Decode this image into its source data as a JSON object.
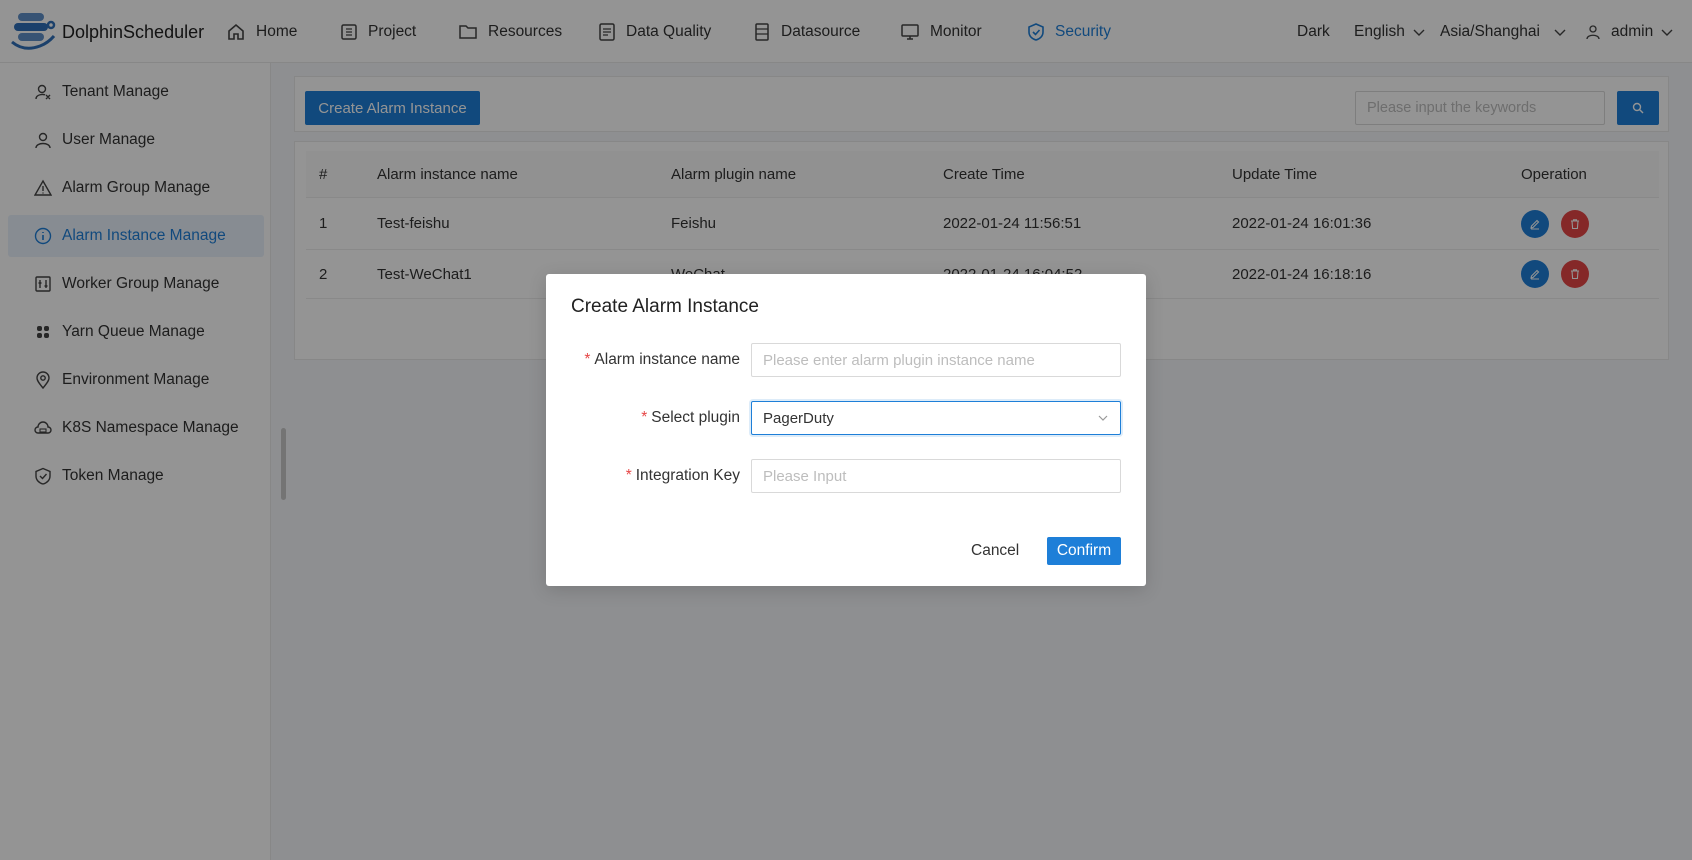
{
  "app": {
    "name": "DolphinScheduler"
  },
  "nav": [
    {
      "label": "Home",
      "icon": "home-icon"
    },
    {
      "label": "Project",
      "icon": "project-icon"
    },
    {
      "label": "Resources",
      "icon": "folder-icon"
    },
    {
      "label": "Data Quality",
      "icon": "data-quality-icon"
    },
    {
      "label": "Datasource",
      "icon": "datasource-icon"
    },
    {
      "label": "Monitor",
      "icon": "monitor-icon"
    },
    {
      "label": "Security",
      "icon": "shield-icon",
      "active": true
    }
  ],
  "header_right": {
    "theme": "Dark",
    "language": "English",
    "timezone": "Asia/Shanghai",
    "user": "admin"
  },
  "sidebar": {
    "items": [
      {
        "label": "Tenant Manage",
        "icon": "tenant-icon"
      },
      {
        "label": "User Manage",
        "icon": "user-icon"
      },
      {
        "label": "Alarm Group Manage",
        "icon": "warning-icon"
      },
      {
        "label": "Alarm Instance Manage",
        "icon": "info-icon",
        "active": true
      },
      {
        "label": "Worker Group Manage",
        "icon": "worker-group-icon"
      },
      {
        "label": "Yarn Queue Manage",
        "icon": "queue-icon"
      },
      {
        "label": "Environment Manage",
        "icon": "location-icon"
      },
      {
        "label": "K8S Namespace Manage",
        "icon": "cloud-icon"
      },
      {
        "label": "Token Manage",
        "icon": "token-shield-icon"
      }
    ]
  },
  "toolbar": {
    "create_label": "Create Alarm Instance",
    "search_placeholder": "Please input the keywords"
  },
  "table": {
    "columns": [
      "#",
      "Alarm instance name",
      "Alarm plugin name",
      "Create Time",
      "Update Time",
      "Operation"
    ],
    "rows": [
      {
        "index": "1",
        "name": "Test-feishu",
        "plugin": "Feishu",
        "create_time": "2022-01-24 11:56:51",
        "update_time": "2022-01-24 16:01:36"
      },
      {
        "index": "2",
        "name": "Test-WeChat1",
        "plugin": "WeChat",
        "create_time": "2022-01-24 16:04:52",
        "update_time": "2022-01-24 16:18:16"
      }
    ]
  },
  "modal": {
    "title": "Create Alarm Instance",
    "fields": {
      "instance_name": {
        "label": "Alarm instance name",
        "placeholder": "Please enter alarm plugin instance name",
        "value": ""
      },
      "plugin": {
        "label": "Select plugin",
        "value": "PagerDuty"
      },
      "integration_key": {
        "label": "Integration Key",
        "placeholder": "Please Input",
        "value": ""
      }
    },
    "cancel_label": "Cancel",
    "confirm_label": "Confirm"
  },
  "colors": {
    "primary": "#1e7fd8",
    "danger": "#e64646",
    "active_bg": "#e9f2fc"
  }
}
